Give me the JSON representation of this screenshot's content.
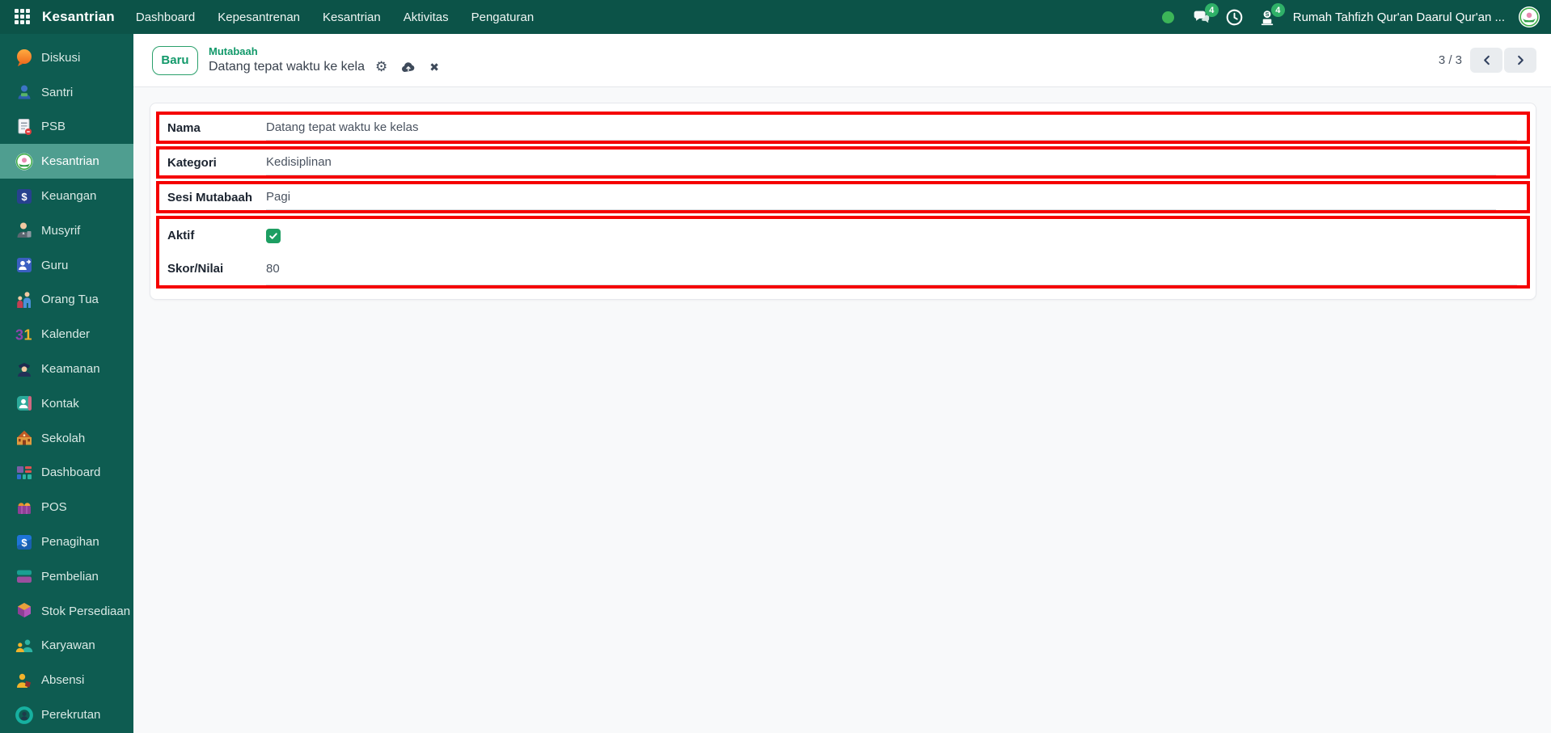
{
  "navbar": {
    "brand": "Kesantrian",
    "menu": [
      {
        "key": "dashboard",
        "label": "Dashboard"
      },
      {
        "key": "kepesantrenan",
        "label": "Kepesantrenan"
      },
      {
        "key": "kesantrian",
        "label": "Kesantrian"
      },
      {
        "key": "aktivitas",
        "label": "Aktivitas"
      },
      {
        "key": "pengaturan",
        "label": "Pengaturan"
      }
    ]
  },
  "systray": {
    "chat_badge": "4",
    "activity_badge": "4",
    "company": "Rumah Tahfizh Qur'an Daarul Qur'an ...",
    "icons": [
      "status-dot",
      "chat-icon",
      "clock-icon",
      "livechat-icon",
      "company-avatar"
    ]
  },
  "sidebar": {
    "active_index": 3,
    "items": [
      {
        "key": "diskusi",
        "label": "Diskusi"
      },
      {
        "key": "santri",
        "label": "Santri"
      },
      {
        "key": "psb",
        "label": "PSB"
      },
      {
        "key": "kesantrian",
        "label": "Kesantrian"
      },
      {
        "key": "keuangan",
        "label": "Keuangan"
      },
      {
        "key": "musyrif",
        "label": "Musyrif"
      },
      {
        "key": "guru",
        "label": "Guru"
      },
      {
        "key": "orang-tua",
        "label": "Orang Tua"
      },
      {
        "key": "kalender",
        "label": "Kalender"
      },
      {
        "key": "keamanan",
        "label": "Keamanan"
      },
      {
        "key": "kontak",
        "label": "Kontak"
      },
      {
        "key": "sekolah",
        "label": "Sekolah"
      },
      {
        "key": "dashboard",
        "label": "Dashboard"
      },
      {
        "key": "pos",
        "label": "POS"
      },
      {
        "key": "penagihan",
        "label": "Penagihan"
      },
      {
        "key": "pembelian",
        "label": "Pembelian"
      },
      {
        "key": "stok-persediaan",
        "label": "Stok Persediaan"
      },
      {
        "key": "karyawan",
        "label": "Karyawan"
      },
      {
        "key": "absensi",
        "label": "Absensi"
      },
      {
        "key": "perekrutan",
        "label": "Perekrutan"
      }
    ]
  },
  "breadcrumb": {
    "new_button": "Baru",
    "parent": "Mutabaah",
    "title": "Datang tepat waktu ke kela",
    "unsaved_icons": [
      "gear-icon",
      "cloud-upload-icon",
      "discard-x-icon"
    ]
  },
  "pager": {
    "text": "3 / 3"
  },
  "form": {
    "fields": [
      {
        "label": "Nama",
        "value": "Datang tepat waktu ke kelas",
        "type": "text"
      },
      {
        "label": "Kategori",
        "value": "Kedisiplinan",
        "type": "many2one"
      },
      {
        "label": "Sesi Mutabaah",
        "value": "Pagi",
        "type": "many2one"
      },
      {
        "label": "Aktif",
        "checked": true,
        "type": "checkbox"
      },
      {
        "label": "Skor/Nilai",
        "value": "80",
        "type": "number"
      }
    ]
  },
  "colors": {
    "navbar": "#0c5348",
    "sidebar": "#0e5c51",
    "sidebar_active": "#4f9e90",
    "accent_green": "#12996a",
    "checkbox_green": "#1d9e62",
    "badge_green": "#2fb168",
    "annotation_red": "#f50000"
  }
}
